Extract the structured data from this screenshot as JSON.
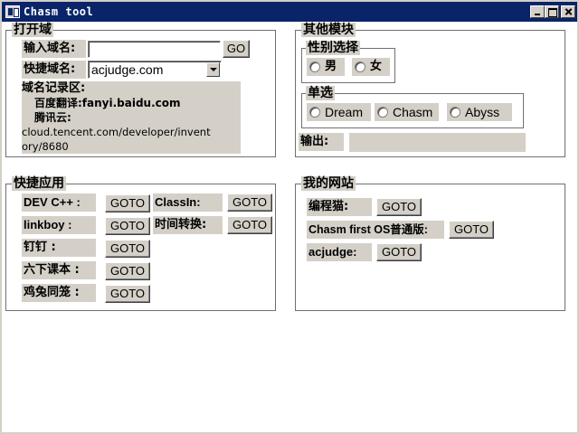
{
  "window": {
    "title": "Chasm tool",
    "controls": {
      "minimize": "",
      "maximize": "",
      "close": ""
    }
  },
  "open_domain": {
    "title": "打开域",
    "input_label": "输入域名:",
    "input_value": "",
    "go_label": "GO",
    "quick_label": "快捷域名:",
    "quick_value": "acjudge.com",
    "record_lines": [
      "域名记录区:",
      "  百度翻译:fanyi.baidu.com",
      "  腾讯云:",
      "cloud.tencent.com/developer/invent",
      "ory/8680"
    ]
  },
  "other_modules": {
    "title": "其他模块",
    "gender_group_title": "性别选择",
    "gender_options": [
      "男",
      "女"
    ],
    "single_group_title": "单选",
    "single_options": [
      "Dream",
      "Chasm",
      "Abyss"
    ],
    "output_label": "输出:",
    "output_value": ""
  },
  "quick_apps": {
    "title": "快捷应用",
    "goto_label": "GOTO",
    "items": [
      {
        "label": "DEV C++ :"
      },
      {
        "label": "linkboy :"
      },
      {
        "label": "钉钉 :"
      },
      {
        "label": "六下课本 :"
      },
      {
        "label": "鸡兔同笼 :"
      },
      {
        "label": "ClassIn:"
      },
      {
        "label": "时间转换:"
      }
    ]
  },
  "my_sites": {
    "title": "我的网站",
    "goto_label": "GOTO",
    "items": [
      {
        "label": "编程猫:"
      },
      {
        "label": "Chasm first OS普通版:"
      },
      {
        "label": "acjudge:"
      }
    ]
  }
}
